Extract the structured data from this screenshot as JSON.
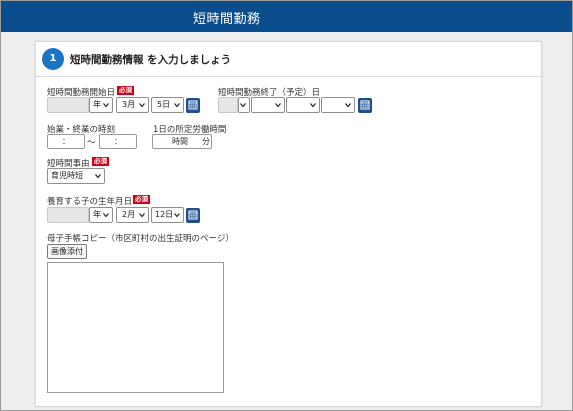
{
  "header": {
    "title": "短時間勤務"
  },
  "section": {
    "step": "1",
    "title": "短時間勤務情報 を入力しましょう"
  },
  "required_badge": "必須",
  "start_date": {
    "label": "短時間勤務開始日",
    "year_value": "",
    "year_suffix": "年",
    "month": "3月",
    "day": "5日"
  },
  "end_date": {
    "label": "短時間勤務終了（予定）日",
    "year_value": "",
    "month": "",
    "day": "",
    "extra": ""
  },
  "work_time": {
    "label": "始業・終業の時刻",
    "start": "：",
    "separator": "〜",
    "end": "："
  },
  "daily_hours": {
    "label": "1日の所定労働時間",
    "hours_unit": "時間",
    "minutes_unit": "分"
  },
  "reason": {
    "label": "短時間事由",
    "value": "育児時短"
  },
  "child_birth": {
    "label": "養育する子の生年月日",
    "year_suffix": "年",
    "month": "2月",
    "day": "12日"
  },
  "copy": {
    "label": "母子手帳コピー（市区町村の出生証明のページ）",
    "attach_button": "画像添付"
  },
  "colors": {
    "header": "#0a4d8c",
    "step": "#1b74c5",
    "required": "#d0001a",
    "calendar": "#1f4f8c"
  },
  "icons": [
    "calendar-icon",
    "chevron-down-icon"
  ]
}
